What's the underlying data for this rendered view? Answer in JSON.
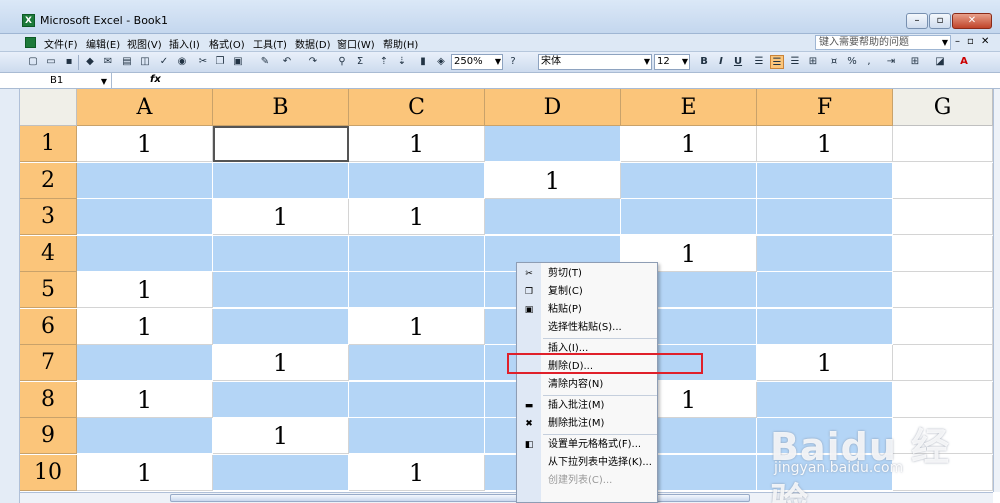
{
  "window": {
    "title": "Microsoft Excel - Book1",
    "help_placeholder": "键入需要帮助的问题"
  },
  "menu": [
    "文件(F)",
    "编辑(E)",
    "视图(V)",
    "插入(I)",
    "格式(O)",
    "工具(T)",
    "数据(D)",
    "窗口(W)",
    "帮助(H)"
  ],
  "toolbar": {
    "zoom": "250%",
    "font": "宋体",
    "size": "12",
    "bold": "B",
    "italic": "I",
    "underline": "U",
    "percent": "%"
  },
  "formula": {
    "name_box": "B1",
    "fx": "fx"
  },
  "columns": [
    "A",
    "B",
    "C",
    "D",
    "E",
    "F",
    "G"
  ],
  "rows": [
    "1",
    "2",
    "3",
    "4",
    "5",
    "6",
    "7",
    "8",
    "9",
    "10"
  ],
  "cells": [
    [
      "1",
      "",
      "1",
      "",
      "1",
      "1",
      ""
    ],
    [
      "",
      "",
      "",
      "1",
      "",
      "",
      ""
    ],
    [
      "",
      "1",
      "1",
      "",
      "",
      "",
      ""
    ],
    [
      "",
      "",
      "",
      "",
      "1",
      "",
      ""
    ],
    [
      "1",
      "",
      "",
      "",
      "",
      "",
      ""
    ],
    [
      "1",
      "",
      "1",
      "",
      "",
      "",
      ""
    ],
    [
      "",
      "1",
      "",
      "",
      "",
      "1",
      ""
    ],
    [
      "1",
      "",
      "",
      "",
      "1",
      "",
      ""
    ],
    [
      "",
      "1",
      "",
      "",
      "",
      "",
      ""
    ],
    [
      "1",
      "",
      "1",
      "",
      "",
      "",
      ""
    ]
  ],
  "selected": [
    [
      false,
      false,
      false,
      true,
      false,
      false,
      false
    ],
    [
      true,
      true,
      true,
      false,
      true,
      true,
      false
    ],
    [
      true,
      false,
      false,
      true,
      true,
      true,
      false
    ],
    [
      true,
      true,
      true,
      true,
      false,
      true,
      false
    ],
    [
      false,
      true,
      true,
      true,
      true,
      true,
      false
    ],
    [
      false,
      true,
      false,
      true,
      true,
      true,
      false
    ],
    [
      true,
      false,
      true,
      true,
      true,
      false,
      false
    ],
    [
      false,
      true,
      true,
      true,
      false,
      true,
      false
    ],
    [
      true,
      false,
      true,
      true,
      true,
      true,
      false
    ],
    [
      false,
      true,
      false,
      true,
      true,
      true,
      false
    ]
  ],
  "context_menu": [
    {
      "label": "剪切(T)",
      "icon": "scissors-icon"
    },
    {
      "label": "复制(C)",
      "icon": "copy-icon"
    },
    {
      "label": "粘贴(P)",
      "icon": "paste-icon"
    },
    {
      "label": "选择性粘贴(S)...",
      "icon": ""
    },
    {
      "label": "插入(I)...",
      "icon": ""
    },
    {
      "label": "删除(D)...",
      "icon": ""
    },
    {
      "label": "清除内容(N)",
      "icon": ""
    },
    {
      "label": "插入批注(M)",
      "icon": "comment-icon"
    },
    {
      "label": "删除批注(M)",
      "icon": "delete-comment-icon"
    },
    {
      "label": "设置单元格格式(F)...",
      "icon": "format-cells-icon"
    },
    {
      "label": "从下拉列表中选择(K)...",
      "icon": ""
    },
    {
      "label": "创建列表(C)...",
      "icon": ""
    }
  ],
  "watermark": {
    "logo": "Baidu 经验",
    "url": "jingyan.baidu.com"
  }
}
